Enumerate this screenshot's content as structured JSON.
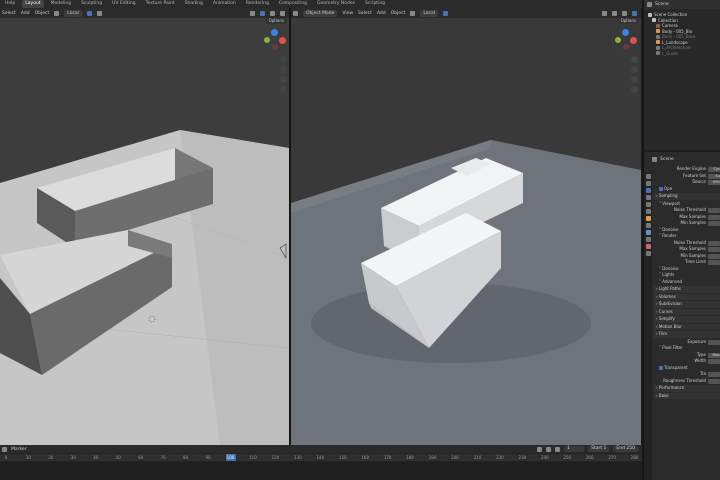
{
  "topbar": {
    "tabs": [
      "Help",
      "Layout",
      "Modeling",
      "Sculpting",
      "UV Editing",
      "Texture Paint",
      "Shading",
      "Animation",
      "Rendering",
      "Compositing",
      "Geometry Nodes",
      "Scripting"
    ],
    "active_tab": "Layout"
  },
  "left_viewport": {
    "header_items": [
      "Select",
      "Add",
      "Object"
    ],
    "transform": "Local",
    "options": "Options"
  },
  "right_viewport": {
    "header_items": [
      "Object Mode",
      "View",
      "Select",
      "Add",
      "Object"
    ],
    "transform": "Local",
    "options": "Options"
  },
  "outliner": {
    "title": "Scene",
    "rows": [
      {
        "label": "Scene Collection",
        "dim": false,
        "icon_color": "#bfbfbf"
      },
      {
        "label": "Collection",
        "dim": false,
        "icon_color": "#bfbfbf"
      },
      {
        "label": "Camera",
        "dim": false,
        "icon_color": "#8b5c5c"
      },
      {
        "label": "Body - 005_Blo",
        "dim": false,
        "icon_color": "#e09a4b"
      },
      {
        "label": "Body - 005_Base",
        "dim": true,
        "icon_color": "#777777"
      },
      {
        "label": "L_Landscape",
        "dim": false,
        "icon_color": "#e09a4b"
      },
      {
        "label": "L_Architecture",
        "dim": true,
        "icon_color": "#777777"
      },
      {
        "label": "L_Guide",
        "dim": true,
        "icon_color": "#777777"
      }
    ]
  },
  "properties": {
    "search": "Scene",
    "rows": [
      {
        "label": "Render Engine",
        "value": "Cyc",
        "kind": "field"
      },
      {
        "label": "Feature Set",
        "value": "Su",
        "kind": "field"
      },
      {
        "label": "Device",
        "value": "GPU",
        "kind": "field"
      },
      {
        "label": "Ope",
        "value": "",
        "kind": "check"
      },
      {
        "label": "Sampling",
        "value": "",
        "kind": "section"
      },
      {
        "label": "Viewport",
        "value": "",
        "kind": "sub"
      },
      {
        "label": "Noise Threshold",
        "value": "",
        "kind": "field"
      },
      {
        "label": "Max Samples",
        "value": "",
        "kind": "field"
      },
      {
        "label": "Min Samples",
        "value": "",
        "kind": "field"
      },
      {
        "label": "Denoise",
        "value": "",
        "kind": "sub"
      },
      {
        "label": "Render",
        "value": "",
        "kind": "sub"
      },
      {
        "label": "Noise Threshold",
        "value": "",
        "kind": "field"
      },
      {
        "label": "Max Samples",
        "value": "",
        "kind": "field"
      },
      {
        "label": "Min Samples",
        "value": "",
        "kind": "field"
      },
      {
        "label": "Time Limit",
        "value": "",
        "kind": "field"
      },
      {
        "label": "Denoise",
        "value": "",
        "kind": "sub"
      },
      {
        "label": "Lights",
        "value": "",
        "kind": "sub"
      },
      {
        "label": "Advanced",
        "value": "",
        "kind": "sub"
      },
      {
        "label": "Light Paths",
        "value": "",
        "kind": "section"
      },
      {
        "label": "Volumes",
        "value": "",
        "kind": "section"
      },
      {
        "label": "Subdivision",
        "value": "",
        "kind": "section"
      },
      {
        "label": "Curves",
        "value": "",
        "kind": "section"
      },
      {
        "label": "Simplify",
        "value": "",
        "kind": "section"
      },
      {
        "label": "Motion Blur",
        "value": "",
        "kind": "section"
      },
      {
        "label": "Film",
        "value": "",
        "kind": "section"
      },
      {
        "label": "Exposure",
        "value": "",
        "kind": "field"
      },
      {
        "label": "Pixel Filter",
        "value": "",
        "kind": "sub"
      },
      {
        "label": "Type",
        "value": "Blac",
        "kind": "field"
      },
      {
        "label": "Width",
        "value": "",
        "kind": "field"
      },
      {
        "label": "Transparent",
        "value": "",
        "kind": "check"
      },
      {
        "label": "Tra",
        "value": "",
        "kind": "field"
      },
      {
        "label": "Roughness Threshold",
        "value": "",
        "kind": "field"
      },
      {
        "label": "Performance",
        "value": "",
        "kind": "section"
      },
      {
        "label": "Bake",
        "value": "",
        "kind": "section"
      }
    ]
  },
  "timeline": {
    "menu": [
      "Marker"
    ],
    "current_frame": "100",
    "start_label": "Start",
    "start": "1",
    "end_label": "End",
    "end": "250",
    "frame_field": "1",
    "ticks": [
      "0",
      "10",
      "20",
      "30",
      "40",
      "50",
      "60",
      "70",
      "80",
      "90",
      "100",
      "110",
      "120",
      "130",
      "140",
      "150",
      "160",
      "170",
      "180",
      "190",
      "200",
      "210",
      "220",
      "230",
      "240",
      "250",
      "260",
      "270",
      "280"
    ]
  },
  "colors": {
    "accent": "#4772b3",
    "gizmo_x": "#e0514f",
    "gizmo_y": "#8cb43c",
    "gizmo_z": "#3d82df"
  }
}
